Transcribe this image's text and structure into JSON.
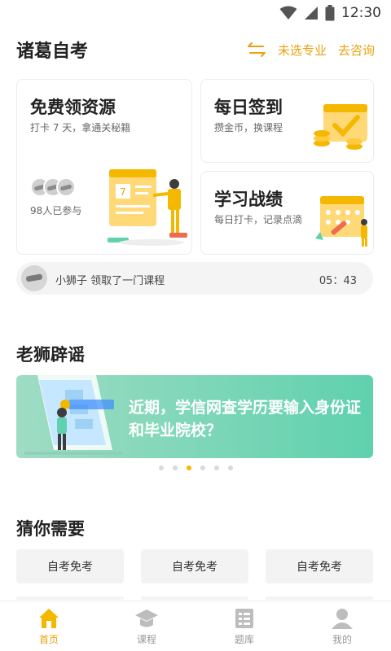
{
  "status_bar": {
    "time": "12:30"
  },
  "header": {
    "title": "诸葛自考",
    "major": "未选专业",
    "consult": "去咨询"
  },
  "cards": {
    "free": {
      "title": "免费领资源",
      "subtitle": "打卡 7 天，拿通关秘籍",
      "participants": "98人已参与",
      "calendar_day": "7"
    },
    "checkin": {
      "title": "每日签到",
      "subtitle": "攒金币，换课程"
    },
    "record": {
      "title": "学习战绩",
      "subtitle": "每日打卡，记录点滴"
    }
  },
  "ticker": {
    "text": "小狮子 领取了一门课程",
    "time": "05：43"
  },
  "rumor": {
    "title": "老狮辟谣",
    "banner_text": "近期，学信网查学历要输入身份证和毕业院校？",
    "dots_count": 6,
    "active_dot": 2
  },
  "guess": {
    "title": "猜你需要",
    "tags": [
      "自考免考",
      "自考免考",
      "自考免考"
    ]
  },
  "tabbar": {
    "tabs": [
      "首页",
      "课程",
      "题库",
      "我的"
    ],
    "active": 0
  },
  "colors": {
    "accent": "#e9a311",
    "banner_start": "#9fdcc4",
    "banner_end": "#5fd1ad",
    "inactive_tab": "#999999"
  }
}
